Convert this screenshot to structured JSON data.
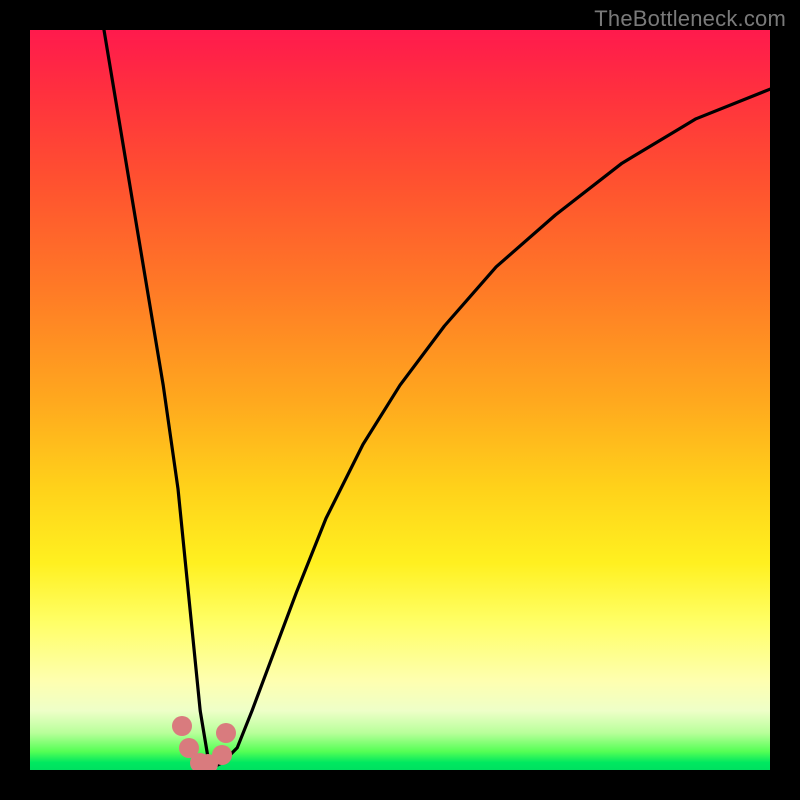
{
  "watermark": "TheBottleneck.com",
  "chart_data": {
    "type": "line",
    "title": "",
    "xlabel": "",
    "ylabel": "",
    "xlim": [
      0,
      100
    ],
    "ylim": [
      0,
      100
    ],
    "grid": false,
    "legend": false,
    "series": [
      {
        "name": "curve",
        "x": [
          10,
          12,
          14,
          16,
          18,
          20,
          21,
          22,
          23,
          24,
          25,
          26,
          28,
          30,
          33,
          36,
          40,
          45,
          50,
          56,
          63,
          71,
          80,
          90,
          100
        ],
        "y": [
          100,
          88,
          76,
          64,
          52,
          38,
          28,
          18,
          8,
          2,
          0.5,
          1,
          3,
          8,
          16,
          24,
          34,
          44,
          52,
          60,
          68,
          75,
          82,
          88,
          92
        ]
      }
    ],
    "markers": [
      {
        "x": 20.5,
        "y": 6.0
      },
      {
        "x": 21.5,
        "y": 3.0
      },
      {
        "x": 23.0,
        "y": 1.0
      },
      {
        "x": 24.0,
        "y": 0.8
      },
      {
        "x": 26.0,
        "y": 2.0
      },
      {
        "x": 26.5,
        "y": 5.0
      }
    ],
    "marker_color": "#d97b7e",
    "curve_color": "#000000"
  }
}
